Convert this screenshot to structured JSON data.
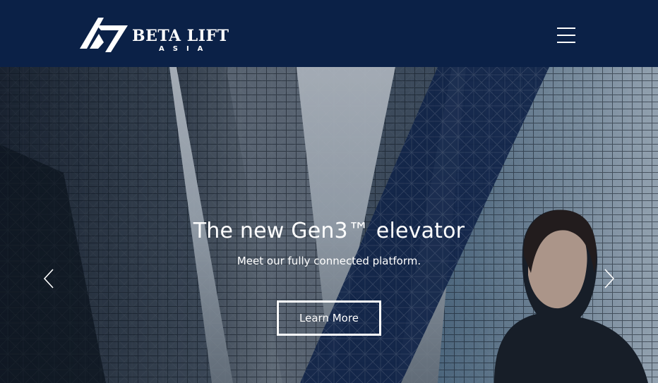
{
  "brand": {
    "name": "BETA LIFT",
    "sub": "ASIA"
  },
  "header": {
    "menu_icon": "hamburger-menu-icon"
  },
  "hero": {
    "title": "The new Gen3™ elevator",
    "subtitle": "Meet our fully connected platform.",
    "cta_label": "Learn More",
    "prev_icon": "chevron-left-icon",
    "next_icon": "chevron-right-icon"
  },
  "colors": {
    "header_bg": "#0b2147",
    "accent_band": "#14264f",
    "text": "#ffffff"
  }
}
